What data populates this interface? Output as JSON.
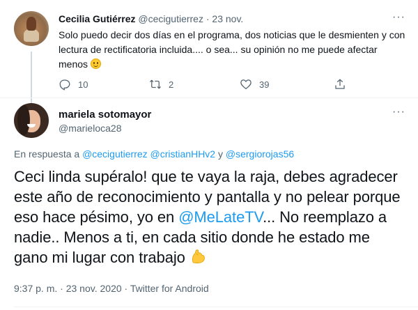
{
  "parent": {
    "name": "Cecilia Gutiérrez",
    "handle": "@cecigutierrez",
    "separator": "·",
    "date": "23 nov.",
    "more": "···",
    "text": "Solo puedo decir dos días en el programa, dos noticias que le desmienten y con lectura de rectificatoria incluida.... o sea... su opinión no me puede afectar menos",
    "emoji": "slightly-smiling-face",
    "actions": {
      "reply_count": "10",
      "retweet_count": "2",
      "like_count": "39"
    }
  },
  "tweet": {
    "name": "mariela sotomayor",
    "handle": "@marieloca28",
    "more": "···",
    "reply_prefix": "En respuesta a ",
    "reply_mentions": [
      "@cecigutierrez",
      "@cristianHHv2",
      "@sergiorojas56"
    ],
    "reply_joiner": "y",
    "text_before": "Ceci linda supéralo! que te vaya la raja, debes agradecer este año de reconocimiento y pantalla y no pelear porque eso hace pésimo, yo en ",
    "mention": "@MeLateTV",
    "text_after": "... No reemplazo a nadie.. Menos a ti, en cada sitio donde he estado me gano mi lugar con trabajo",
    "emoji": "flexed-biceps",
    "time": "9:37 p. m.",
    "date": "23 nov. 2020",
    "source": "Twitter for Android",
    "separator": "·"
  },
  "colors": {
    "link": "#1d9bf0",
    "muted": "#536471",
    "text": "#0f1419"
  }
}
